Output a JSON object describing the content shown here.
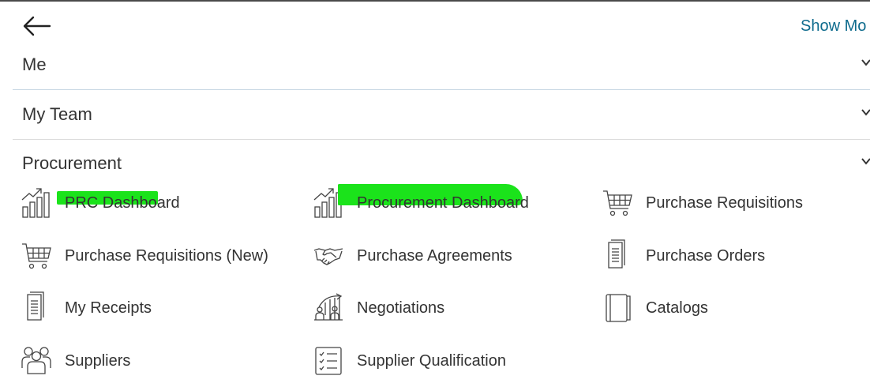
{
  "header": {
    "show_more": "Show Mo"
  },
  "sections": [
    {
      "title": "Me"
    },
    {
      "title": "My Team"
    },
    {
      "title": "Procurement"
    }
  ],
  "apps": [
    {
      "label": "PRC Dashboard",
      "icon": "dashboard-chart-icon"
    },
    {
      "label": "Procurement Dashboard",
      "icon": "dashboard-chart-icon"
    },
    {
      "label": "Purchase Requisitions",
      "icon": "shopping-cart-icon"
    },
    {
      "label": "Purchase Requisitions (New)",
      "icon": "shopping-cart-icon"
    },
    {
      "label": "Purchase Agreements",
      "icon": "handshake-icon"
    },
    {
      "label": "Purchase Orders",
      "icon": "document-icon"
    },
    {
      "label": "My Receipts",
      "icon": "document-icon"
    },
    {
      "label": "Negotiations",
      "icon": "negotiation-icon"
    },
    {
      "label": "Catalogs",
      "icon": "catalog-book-icon"
    },
    {
      "label": "Suppliers",
      "icon": "suppliers-group-icon"
    },
    {
      "label": "Supplier Qualification",
      "icon": "checklist-icon"
    }
  ],
  "colors": {
    "link": "#0e6b8d",
    "highlight": "#1be31b",
    "text": "#333333",
    "divider": "#d7dde2"
  }
}
